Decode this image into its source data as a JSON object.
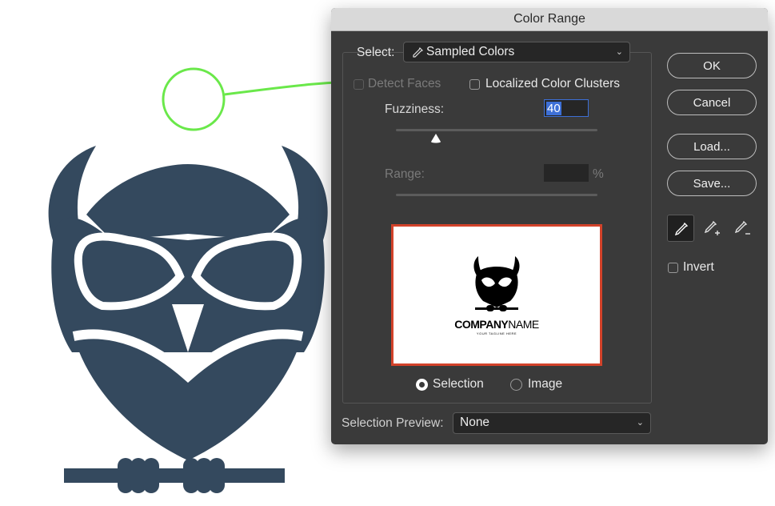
{
  "dialog": {
    "title": "Color Range",
    "select_label": "Select:",
    "select_value": "Sampled Colors",
    "detect_faces_label": "Detect Faces",
    "localized_label": "Localized Color Clusters",
    "fuzziness_label": "Fuzziness:",
    "fuzziness_value": "40",
    "fuzziness_level": 40,
    "fuzziness_max": 200,
    "range_label": "Range:",
    "range_unit": "%",
    "preview_company_a": "COMPANY",
    "preview_company_b": "NAME",
    "preview_tagline": "YOUR TAGLINE HERE",
    "radio_selection_label": "Selection",
    "radio_image_label": "Image",
    "selection_preview_label": "Selection Preview:",
    "selection_preview_value": "None",
    "buttons": {
      "ok": "OK",
      "cancel": "Cancel",
      "load": "Load...",
      "save": "Save..."
    },
    "invert_label": "Invert"
  },
  "colors": {
    "owl": "#34495e",
    "annotation": "#6ae84a",
    "preview_border": "#d2422a",
    "dialog_bg": "#3a3a3a",
    "highlight": "#3d6fd6"
  }
}
